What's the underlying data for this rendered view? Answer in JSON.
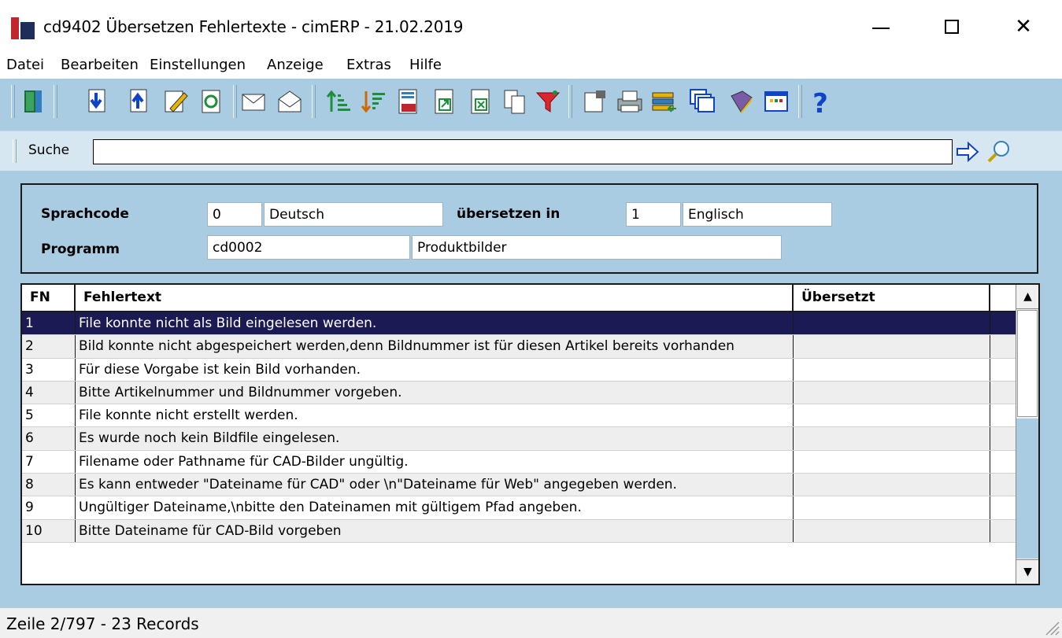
{
  "window": {
    "title": "cd9402 Übersetzen Fehlertexte - cimERP - 21.02.2019",
    "controls": [
      "—",
      "☐",
      "✕"
    ]
  },
  "menu": [
    "Datei",
    "Bearbeiten",
    "Einstellungen",
    "Anzeige",
    "Extras",
    "Hilfe"
  ],
  "toolbar": {
    "icons": [
      "exit-door-icon",
      "move-down-icon",
      "move-up-icon",
      "edit-pencil-icon",
      "refresh-icon",
      "mail-icon",
      "sort-ascending-icon",
      "sort-descending-icon",
      "number-format-icon",
      "export-icon",
      "excel-export-icon",
      "copy-icon",
      "filter-icon",
      "properties-icon",
      "print-icon",
      "transfer-icon",
      "windows-icon",
      "book-icon",
      "calendar-grid-icon",
      "help-icon"
    ]
  },
  "search": {
    "label": "Suche",
    "value": ""
  },
  "header": {
    "sprachcode_label": "Sprachcode",
    "sprachcode_code": "0",
    "sprachcode_name": "Deutsch",
    "uebersetzen_label": "übersetzen in",
    "uebersetzen_code": "1",
    "uebersetzen_name": "Englisch",
    "programm_label": "Programm",
    "programm_code": "cd0002",
    "programm_name": "Produktbilder"
  },
  "grid": {
    "columns": {
      "fn": "FN",
      "text": "Fehlertext",
      "translated": "Übersetzt"
    },
    "rows": [
      {
        "fn": "1",
        "text": "File konnte nicht als Bild eingelesen werden.",
        "translated": ""
      },
      {
        "fn": "2",
        "text": "Bild konnte nicht abgespeichert werden,denn Bildnummer ist für diesen Artikel bereits vorhanden",
        "translated": ""
      },
      {
        "fn": "3",
        "text": "Für diese Vorgabe ist kein Bild vorhanden.",
        "translated": ""
      },
      {
        "fn": "4",
        "text": "Bitte Artikelnummer und Bildnummer vorgeben.",
        "translated": ""
      },
      {
        "fn": "5",
        "text": "File konnte nicht erstellt werden.",
        "translated": ""
      },
      {
        "fn": "6",
        "text": "Es wurde noch kein Bildfile eingelesen.",
        "translated": ""
      },
      {
        "fn": "7",
        "text": "Filename oder Pathname für CAD-Bilder ungültig.",
        "translated": ""
      },
      {
        "fn": "8",
        "text": "Es kann entweder \"Dateiname für CAD\" oder \\n\"Dateiname für Web\" angegeben werden.",
        "translated": ""
      },
      {
        "fn": "9",
        "text": "Ungültiger Dateiname,\\nbitte den Dateinamen mit gültigem Pfad angeben.",
        "translated": ""
      },
      {
        "fn": "10",
        "text": "Bitte Dateiname für CAD-Bild vorgeben",
        "translated": ""
      }
    ],
    "selected_row": 0,
    "scroll_up": "▲",
    "scroll_down": "▼"
  },
  "status": {
    "text": "Zeile 2/797 - 23 Records"
  },
  "colors": {
    "background": "#a9cce3",
    "selection": "#1c1a55"
  }
}
